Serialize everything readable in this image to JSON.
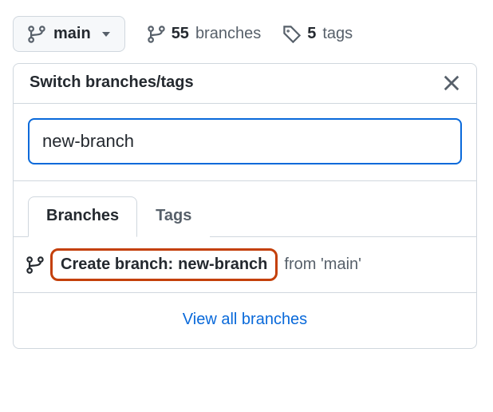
{
  "toolbar": {
    "current_branch": "main",
    "branches_count": "55",
    "branches_label": "branches",
    "tags_count": "5",
    "tags_label": "tags"
  },
  "popup": {
    "title": "Switch branches/tags",
    "search_value": "new-branch",
    "tabs": {
      "branches": "Branches",
      "tags": "Tags"
    },
    "create": {
      "prefix": "Create branch:",
      "name": "new-branch",
      "from": "from 'main'"
    },
    "view_all": "View all branches"
  }
}
